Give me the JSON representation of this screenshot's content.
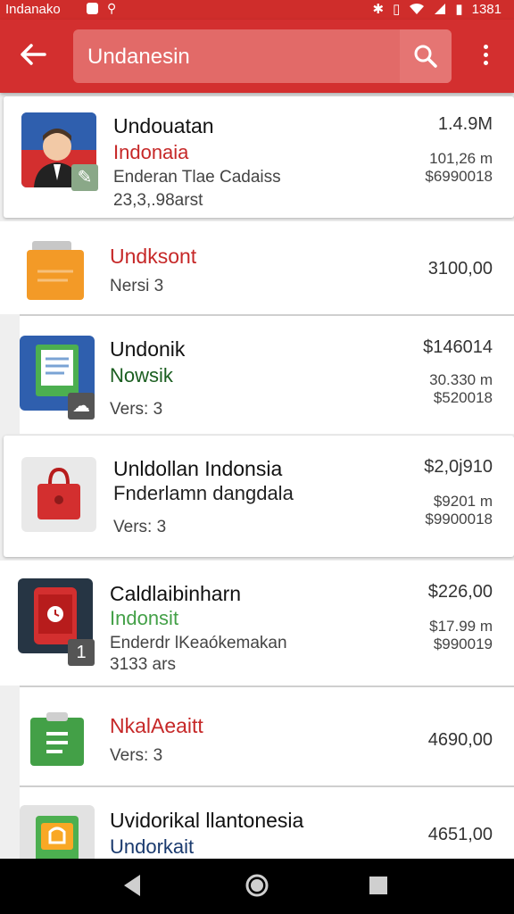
{
  "status_bar": {
    "carrier": "Indanako",
    "time": "1381"
  },
  "toolbar": {
    "search_value": "Undanesin"
  },
  "items": [
    {
      "title": "Undouatan",
      "subtitle": "Indonaia",
      "line3": "Enderan Tlae Cadaiss",
      "line4": "23,3,.98arst",
      "price": "1.4.9M",
      "size1": "101,26 m",
      "size2": "$6990018"
    },
    {
      "title": "Undksont",
      "meta": "Nersi 3",
      "price": "3100,00"
    },
    {
      "title": "Undonik",
      "subtitle": "Nowsik",
      "meta": "Vers: 3",
      "price": "$146014",
      "size1": "30.330 m",
      "size2": "$520018"
    },
    {
      "title": "Unldollan Indonsia",
      "subtitle": "Fnderlamn dangdala",
      "meta": "Vers: 3",
      "price": "$2,0j910",
      "size1": "$9201 m",
      "size2": "$9900018"
    },
    {
      "title": "Caldlaibinharn",
      "subtitle": "Indonsit",
      "line3": "Enderdr lKeaókemakan",
      "line4": "3133 ars",
      "badge": "1",
      "price": "$226,00",
      "size1": "$17.99 m",
      "size2": "$990019"
    },
    {
      "title": "NkalAeaitt",
      "meta": "Vers: 3",
      "price": "4690,00"
    },
    {
      "title": "Uvidorikal llantonesia",
      "subtitle": "Undorkait",
      "price": "4651,00"
    }
  ]
}
